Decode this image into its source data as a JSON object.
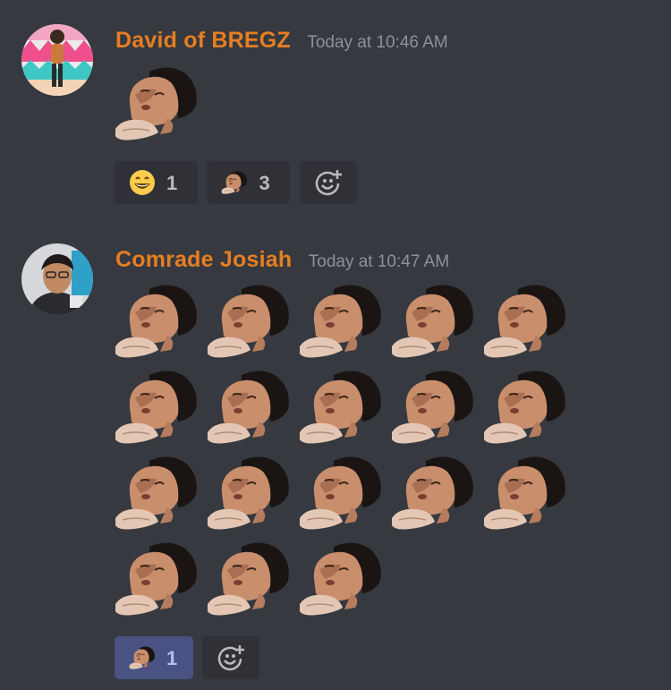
{
  "messages": [
    {
      "author": "David of BREGZ",
      "timestamp": "Today at 10:46 AM",
      "emote_name": "sleeping-face-emote",
      "emote_count": 1,
      "reactions": [
        {
          "icon": "grinning-emoji-icon",
          "count": "1",
          "reacted": false
        },
        {
          "icon": "sleeping-face-emote-icon",
          "count": "3",
          "reacted": false
        }
      ]
    },
    {
      "author": "Comrade Josiah",
      "timestamp": "Today at 10:47 AM",
      "emote_name": "sleeping-face-emote",
      "emote_count": 18,
      "reactions": [
        {
          "icon": "sleeping-face-emote-icon",
          "count": "1",
          "reacted": true
        }
      ]
    }
  ],
  "colors": {
    "background": "#36393f",
    "username": "#e67e22",
    "timestamp": "#8e9297",
    "reaction_bg": "#2f3136",
    "reaction_active_bg": "#4a5283"
  },
  "icons": {
    "add_reaction": "add-reaction-icon"
  }
}
